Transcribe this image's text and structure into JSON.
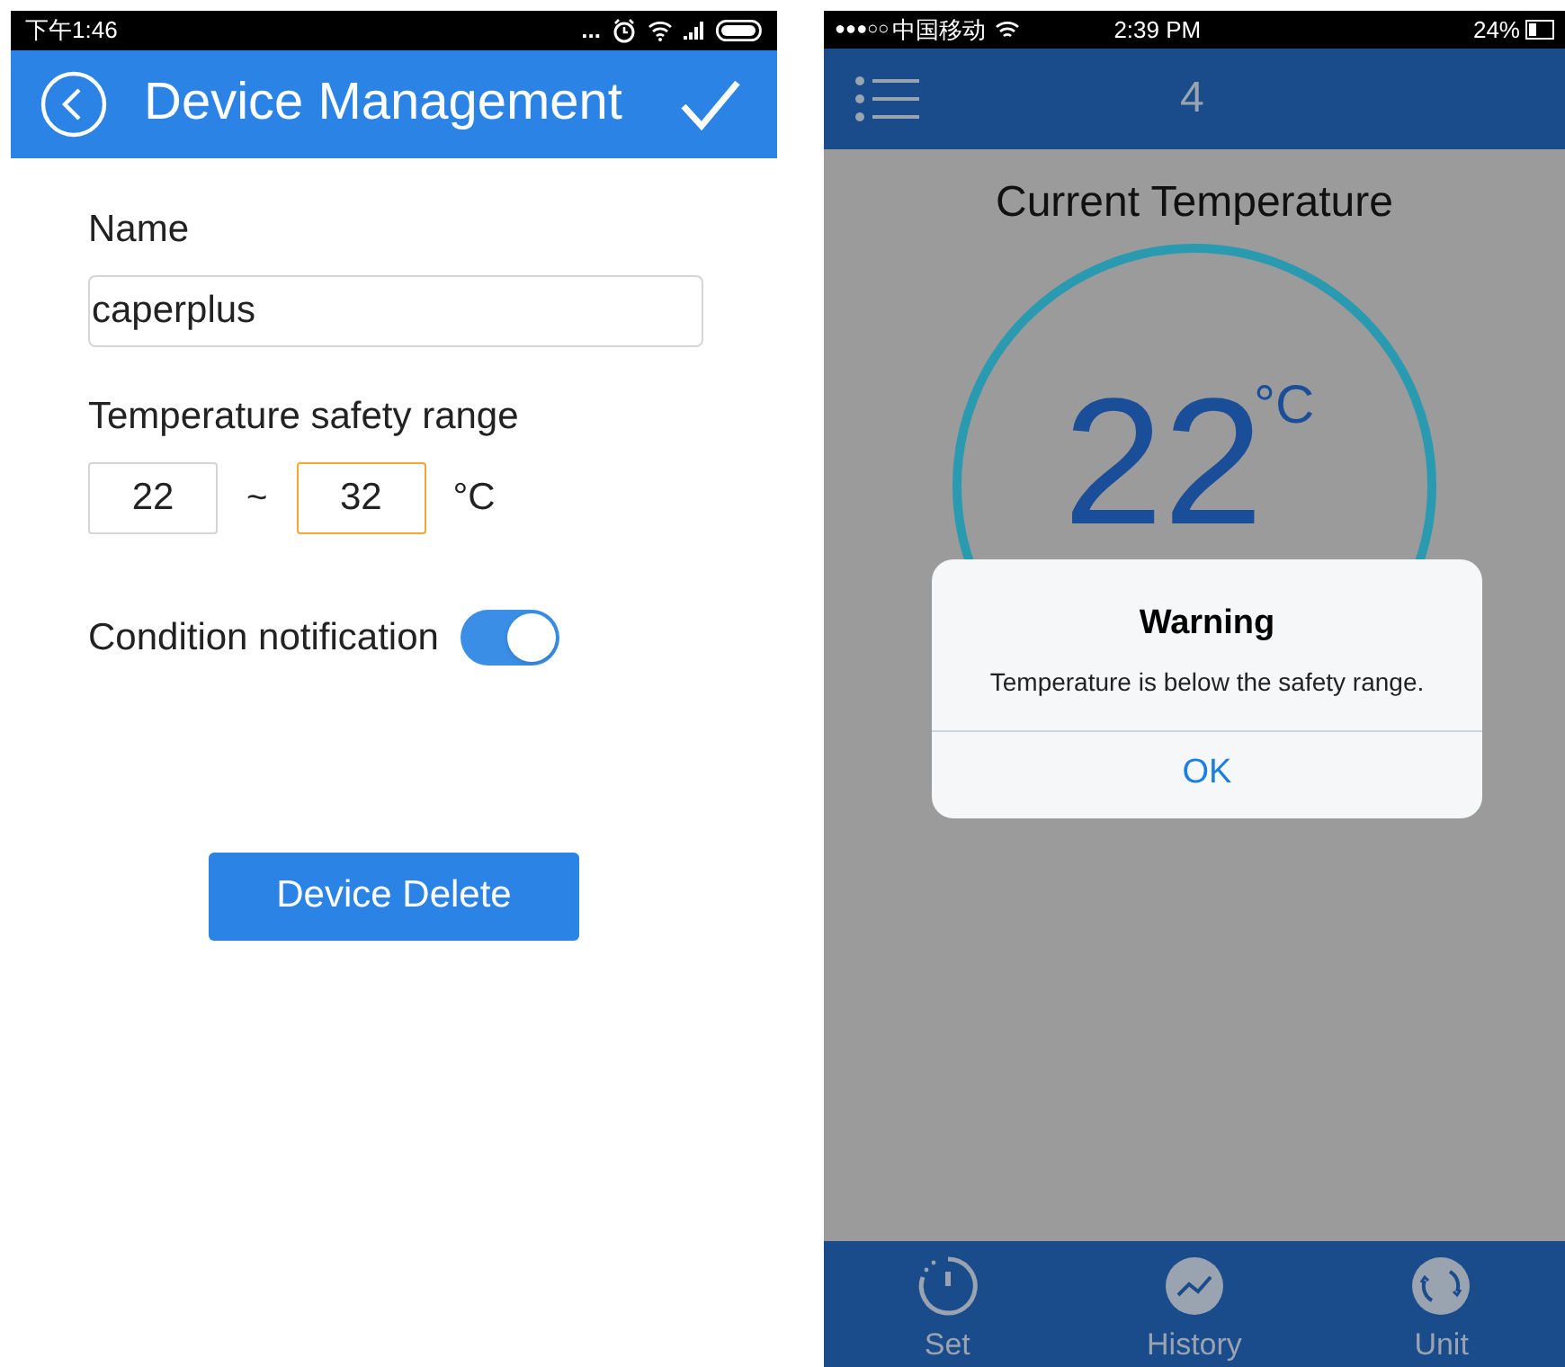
{
  "left_phone": {
    "status_bar": {
      "time": "下午1:46",
      "more": "..."
    },
    "header": {
      "title": "Device Management"
    },
    "name_field": {
      "label": "Name",
      "value": "caperplus"
    },
    "range": {
      "label": "Temperature safety range",
      "fields": [
        {
          "value": "22",
          "focused": false
        },
        {
          "value": "32",
          "focused": true
        }
      ],
      "separator": "~",
      "unit": "°C"
    },
    "notification": {
      "label": "Condition notification",
      "on": true
    },
    "delete_button": "Device Delete"
  },
  "right_phone": {
    "status_bar": {
      "signal": "●●●○○",
      "carrier": "中国移动",
      "time": "2:39 PM",
      "battery": "24%"
    },
    "header": {
      "title": "4"
    },
    "temperature": {
      "heading": "Current Temperature",
      "value": "22",
      "unit": "°C"
    },
    "dialog": {
      "title": "Warning",
      "message": "Temperature is below the safety range.",
      "button": "OK"
    },
    "tabs": [
      {
        "label": "Set",
        "kind": "timer"
      },
      {
        "label": "History",
        "kind": "chart"
      },
      {
        "label": "Unit",
        "kind": "unit"
      }
    ]
  }
}
